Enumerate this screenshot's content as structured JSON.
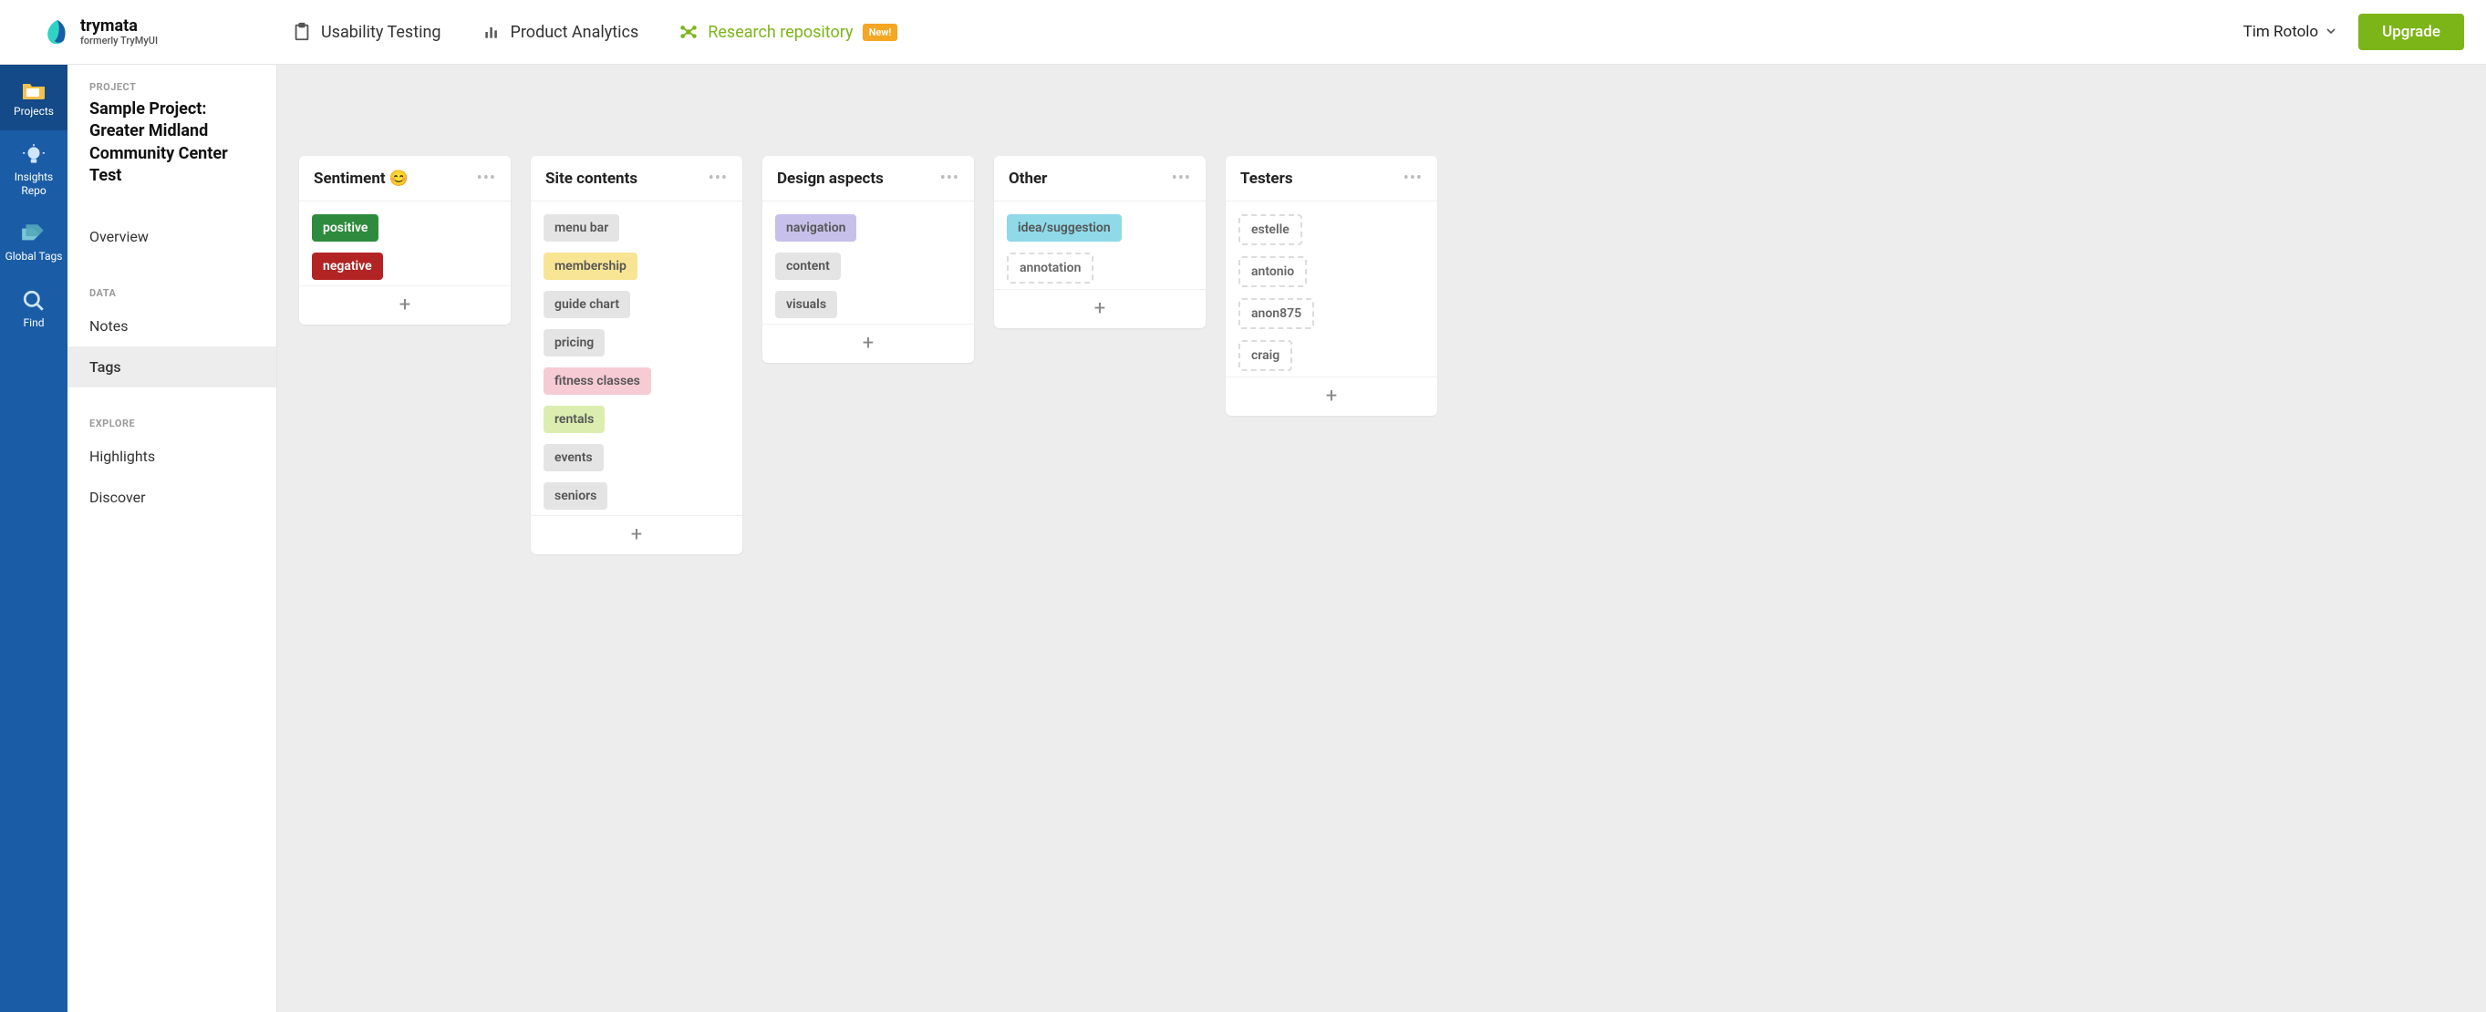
{
  "brand": {
    "name": "trymata",
    "sub": "formerly TryMyUI"
  },
  "topnav": {
    "usability": "Usability Testing",
    "analytics": "Product Analytics",
    "repo": "Research repository",
    "badge": "New!"
  },
  "user": {
    "name": "Tim Rotolo"
  },
  "upgrade": "Upgrade",
  "rail": {
    "projects": "Projects",
    "insights": "Insights Repo",
    "tags": "Global Tags",
    "find": "Find"
  },
  "panel": {
    "project_label": "PROJECT",
    "project_title": "Sample Project: Greater Midland Community Center Test",
    "overview": "Overview",
    "data_label": "DATA",
    "notes": "Notes",
    "tags": "Tags",
    "explore_label": "EXPLORE",
    "highlights": "Highlights",
    "discover": "Discover"
  },
  "columns": [
    {
      "title": "Sentiment 😊",
      "tags": [
        {
          "label": "positive",
          "style": "tag-positive"
        },
        {
          "label": "negative",
          "style": "tag-negative"
        }
      ]
    },
    {
      "title": "Site contents",
      "tags": [
        {
          "label": "menu bar",
          "style": "tag-grey"
        },
        {
          "label": "membership",
          "style": "tag-yellow"
        },
        {
          "label": "guide chart",
          "style": "tag-grey"
        },
        {
          "label": "pricing",
          "style": "tag-grey"
        },
        {
          "label": "fitness classes",
          "style": "tag-pink"
        },
        {
          "label": "rentals",
          "style": "tag-lime"
        },
        {
          "label": "events",
          "style": "tag-grey"
        },
        {
          "label": "seniors",
          "style": "tag-grey"
        }
      ]
    },
    {
      "title": "Design aspects",
      "tags": [
        {
          "label": "navigation",
          "style": "tag-purple"
        },
        {
          "label": "content",
          "style": "tag-grey"
        },
        {
          "label": "visuals",
          "style": "tag-grey"
        }
      ]
    },
    {
      "title": "Other",
      "tags": [
        {
          "label": "idea/suggestion",
          "style": "tag-cyan"
        },
        {
          "label": "annotation",
          "style": "tag-dashed"
        }
      ]
    },
    {
      "title": "Testers",
      "tags": [
        {
          "label": "estelle",
          "style": "tag-dashed"
        },
        {
          "label": "antonio",
          "style": "tag-dashed"
        },
        {
          "label": "anon875",
          "style": "tag-dashed"
        },
        {
          "label": "craig",
          "style": "tag-dashed"
        }
      ]
    }
  ]
}
